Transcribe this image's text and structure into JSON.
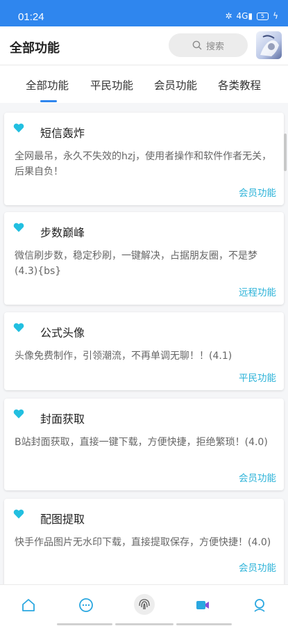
{
  "status_bar": {
    "time": "01:24",
    "signal": "4G",
    "battery": "5"
  },
  "header": {
    "title": "全部功能",
    "search_label": "搜索"
  },
  "tabs": [
    {
      "label": "全部功能",
      "active": true
    },
    {
      "label": "平民功能",
      "active": false
    },
    {
      "label": "会员功能",
      "active": false
    },
    {
      "label": "各类教程",
      "active": false
    }
  ],
  "cards": [
    {
      "title": "短信轰炸",
      "desc": "全网最吊，永久不失效的hzj，使用者操作和软件作者无关，后果自负！",
      "tag": "会员功能"
    },
    {
      "title": "步数巅峰",
      "desc": "微信刷步数，稳定秒刷，一键解决，占据朋友圈，不是梦(4.3){bs}",
      "tag": "远程功能"
    },
    {
      "title": "公式头像",
      "desc": "头像免费制作，引领潮流，不再单调无聊！！(4.1)",
      "tag": "平民功能"
    },
    {
      "title": "封面获取",
      "desc": "B站封面获取，直接一键下载，方便快捷，拒绝繁琐！(4.0)",
      "tag": "会员功能"
    },
    {
      "title": "配图提取",
      "desc": "快手作品图片无水印下载，直接提取保存，方便快捷！(4.0)",
      "tag": "会员功能"
    }
  ],
  "bottom_nav": [
    {
      "icon": "home-icon"
    },
    {
      "icon": "chat-icon"
    },
    {
      "icon": "fingerprint-icon"
    },
    {
      "icon": "video-icon"
    },
    {
      "icon": "profile-icon"
    }
  ],
  "colors": {
    "accent": "#2f86ee",
    "tag": "#2ab2d8",
    "heart": "#22bfe0"
  }
}
